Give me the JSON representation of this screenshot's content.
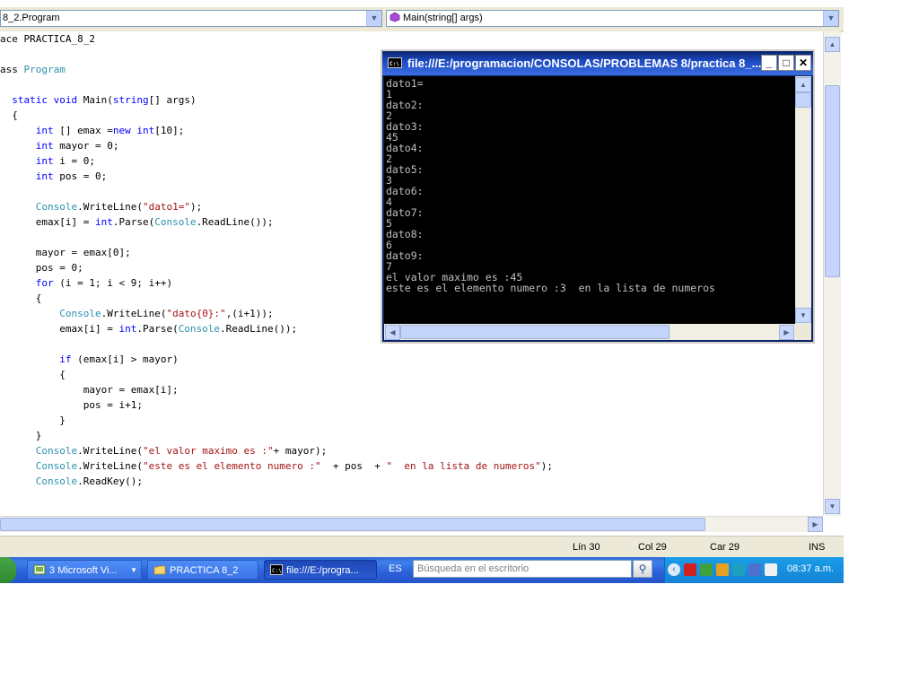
{
  "nav": {
    "type_combo": "8_2.Program",
    "member_combo": "Main(string[] args)"
  },
  "code": [
    [
      [
        "ace PRACTICA_8_2",
        "t"
      ]
    ],
    [],
    [
      [
        "ass ",
        "t"
      ],
      [
        "Program",
        "ty"
      ]
    ],
    [],
    [
      [
        "  ",
        "t"
      ],
      [
        "static",
        "kw"
      ],
      [
        " ",
        "t"
      ],
      [
        "void",
        "kw"
      ],
      [
        " Main(",
        "t"
      ],
      [
        "string",
        "kw"
      ],
      [
        "[] args)",
        "t"
      ]
    ],
    [
      [
        "  {",
        "t"
      ]
    ],
    [
      [
        "      ",
        "t"
      ],
      [
        "int",
        "kw"
      ],
      [
        " [] emax =",
        "t"
      ],
      [
        "new",
        "kw"
      ],
      [
        " ",
        "t"
      ],
      [
        "int",
        "kw"
      ],
      [
        "[10];",
        "t"
      ]
    ],
    [
      [
        "      ",
        "t"
      ],
      [
        "int",
        "kw"
      ],
      [
        " mayor = 0;",
        "t"
      ]
    ],
    [
      [
        "      ",
        "t"
      ],
      [
        "int",
        "kw"
      ],
      [
        " i = 0;",
        "t"
      ]
    ],
    [
      [
        "      ",
        "t"
      ],
      [
        "int",
        "kw"
      ],
      [
        " pos = 0;",
        "t"
      ]
    ],
    [],
    [
      [
        "      ",
        "t"
      ],
      [
        "Console",
        "ty"
      ],
      [
        ".WriteLine(",
        "t"
      ],
      [
        "\"dato1=\"",
        "st"
      ],
      [
        ");",
        "t"
      ]
    ],
    [
      [
        "      emax[i] = ",
        "t"
      ],
      [
        "int",
        "kw"
      ],
      [
        ".Parse(",
        "t"
      ],
      [
        "Console",
        "ty"
      ],
      [
        ".ReadLine());",
        "t"
      ]
    ],
    [],
    [
      [
        "      mayor = emax[0];",
        "t"
      ]
    ],
    [
      [
        "      pos = 0;",
        "t"
      ]
    ],
    [
      [
        "      ",
        "t"
      ],
      [
        "for",
        "kw"
      ],
      [
        " (i = 1; i < 9; i++)",
        "t"
      ]
    ],
    [
      [
        "      {",
        "t"
      ]
    ],
    [
      [
        "          ",
        "t"
      ],
      [
        "Console",
        "ty"
      ],
      [
        ".WriteLine(",
        "t"
      ],
      [
        "\"dato{0}:\"",
        "st"
      ],
      [
        ",(i+1));",
        "t"
      ]
    ],
    [
      [
        "          emax[i] = ",
        "t"
      ],
      [
        "int",
        "kw"
      ],
      [
        ".Parse(",
        "t"
      ],
      [
        "Console",
        "ty"
      ],
      [
        ".ReadLine());",
        "t"
      ]
    ],
    [],
    [
      [
        "          ",
        "t"
      ],
      [
        "if",
        "kw"
      ],
      [
        " (emax[i] > mayor)",
        "t"
      ]
    ],
    [
      [
        "          {",
        "t"
      ]
    ],
    [
      [
        "              mayor = emax[i];",
        "t"
      ]
    ],
    [
      [
        "              pos = i+1;",
        "t"
      ]
    ],
    [
      [
        "          }",
        "t"
      ]
    ],
    [
      [
        "      }",
        "t"
      ]
    ],
    [
      [
        "      ",
        "t"
      ],
      [
        "Console",
        "ty"
      ],
      [
        ".WriteLine(",
        "t"
      ],
      [
        "\"el valor maximo es :\"",
        "st"
      ],
      [
        "+ mayor);",
        "t"
      ]
    ],
    [
      [
        "      ",
        "t"
      ],
      [
        "Console",
        "ty"
      ],
      [
        ".WriteLine(",
        "t"
      ],
      [
        "\"este es el elemento numero :\"",
        "st"
      ],
      [
        "  + pos  + ",
        "t"
      ],
      [
        "\"  en la lista de numeros\"",
        "st"
      ],
      [
        ");",
        "t"
      ]
    ],
    [
      [
        "      ",
        "t"
      ],
      [
        "Console",
        "ty"
      ],
      [
        ".ReadKey();",
        "t"
      ]
    ]
  ],
  "status": {
    "line": "Lín 30",
    "col": "Col 29",
    "car": "Car 29",
    "ins": "INS"
  },
  "console": {
    "title": "file:///E:/programacion/CONSOLAS/PROBLEMAS 8/practica 8_...",
    "min": "_",
    "max": "□",
    "close": "✕",
    "lines": [
      "dato1=",
      "1",
      "dato2:",
      "2",
      "dato3:",
      "45",
      "dato4:",
      "2",
      "dato5:",
      "3",
      "dato6:",
      "4",
      "dato7:",
      "5",
      "dato8:",
      "6",
      "dato9:",
      "7",
      "el valor maximo es :45",
      "este es el elemento numero :3  en la lista de numeros"
    ]
  },
  "taskbar": {
    "btn1": "3 Microsoft Vi...",
    "btn2": "PRACTICA 8_2",
    "btn3": "file:///E:/progra...",
    "lang": "ES",
    "search_placeholder": "Búsqueda en el escritorio",
    "clock": "08:37 a.m."
  },
  "colors": {
    "keyword": "#0000ff",
    "type": "#2b91af",
    "string": "#a31515",
    "taskbar": "#2b5fd9",
    "console_bg": "#000000"
  }
}
